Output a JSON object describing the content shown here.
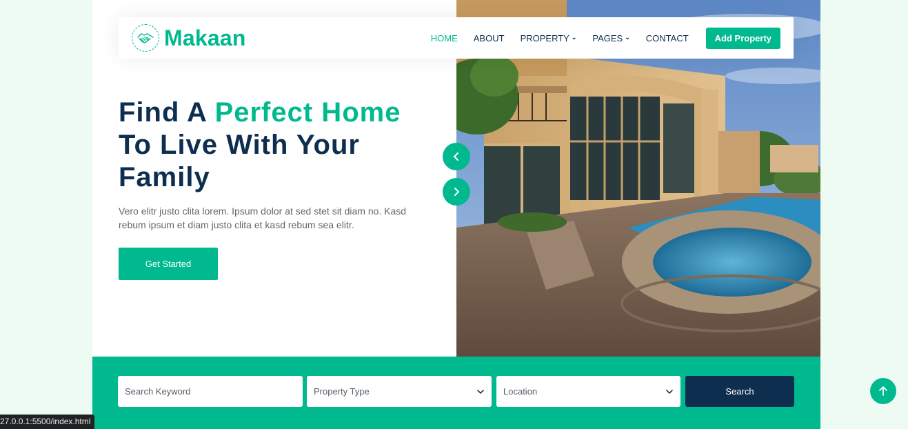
{
  "brand": {
    "name": "Makaan",
    "icon": "handshake-icon"
  },
  "nav": {
    "items": [
      {
        "label": "HOME",
        "active": true
      },
      {
        "label": "ABOUT"
      },
      {
        "label": "PROPERTY",
        "dropdown": true
      },
      {
        "label": "PAGES",
        "dropdown": true
      },
      {
        "label": "CONTACT"
      }
    ],
    "cta": "Add Property"
  },
  "hero": {
    "title_line1_prefix": "Find A ",
    "title_line1_accent": "Perfect Home",
    "title_line2": "To Live With Your",
    "title_line3": "Family",
    "text": "Vero elitr justo clita lorem. Ipsum dolor at sed stet sit diam no. Kasd rebum ipsum et diam justo clita et kasd rebum sea elitr.",
    "button": "Get Started"
  },
  "carousel": {
    "prev_icon": "chevron-left-icon",
    "next_icon": "chevron-right-icon"
  },
  "search": {
    "keyword_placeholder": "Search Keyword",
    "type_selected": "Property Type",
    "location_selected": "Location",
    "button": "Search"
  },
  "status_url": "27.0.0.1:5500/index.html",
  "colors": {
    "primary": "#00b98e",
    "dark": "#0e2e50",
    "bg": "#eefbf3"
  }
}
